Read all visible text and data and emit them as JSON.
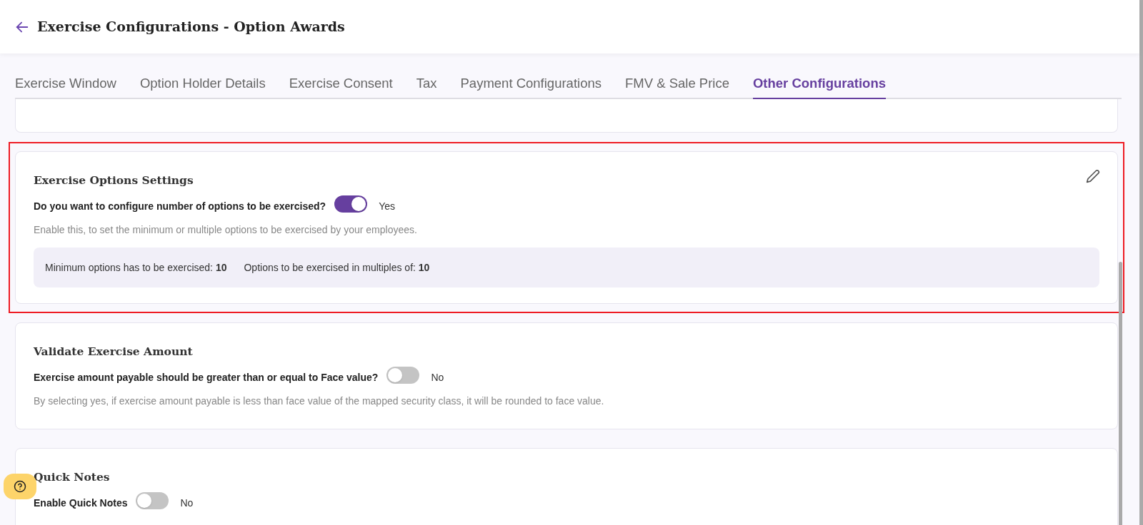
{
  "header": {
    "title": "Exercise Configurations - Option Awards"
  },
  "tabs": [
    {
      "label": "Exercise Window",
      "selected": false
    },
    {
      "label": "Option Holder Details",
      "selected": false
    },
    {
      "label": "Exercise Consent",
      "selected": false
    },
    {
      "label": "Tax",
      "selected": false
    },
    {
      "label": "Payment Configurations",
      "selected": false
    },
    {
      "label": "FMV & Sale Price",
      "selected": false
    },
    {
      "label": "Other Configurations",
      "selected": true
    }
  ],
  "sections": [
    {
      "kind": "partial"
    },
    {
      "kind": "setting",
      "highlighted": true,
      "editable": true,
      "title": "Exercise Options Settings",
      "question": "Do you want to configure number of options to be exercised?",
      "on": true,
      "answer": "Yes",
      "description": "Enable this, to set the minimum or multiple options to be exercised by your employees.",
      "values": [
        "Minimum options has to be exercised: **10**",
        "Options to be exercised in multiples of: **10**"
      ]
    },
    {
      "kind": "setting",
      "title": "Validate Exercise Amount",
      "question": "Exercise amount payable should be greater than or equal to Face value?",
      "on": false,
      "answer": "No",
      "description": "By selecting yes, if exercise amount payable is less than face value of the mapped security class, it will be rounded to face value."
    },
    {
      "kind": "setting",
      "title": "Quick Notes",
      "question": "Enable Quick Notes",
      "on": false,
      "answer": "No"
    }
  ]
}
